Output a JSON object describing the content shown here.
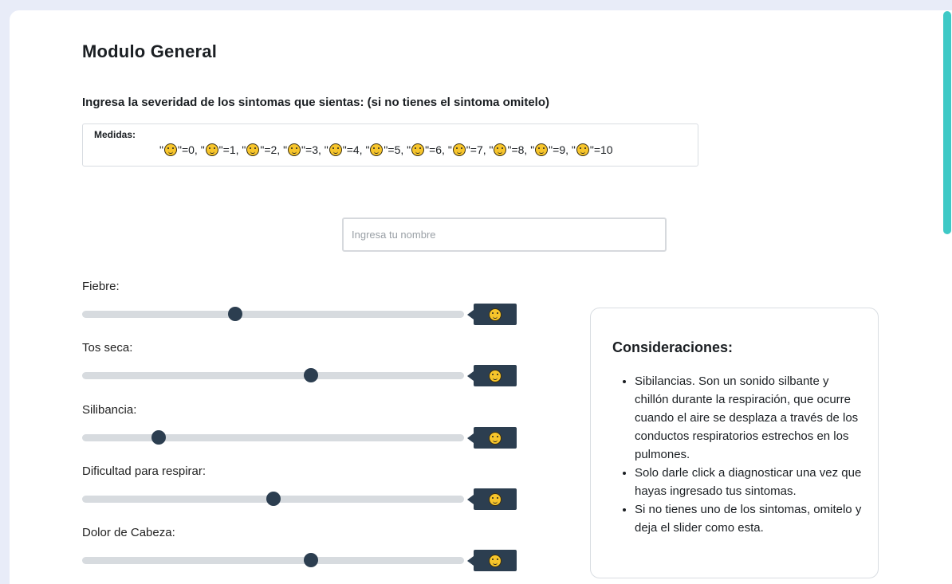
{
  "page": {
    "title": "Modulo General",
    "instructions": "Ingresa la severidad de los sintomas que sientas: (si no tienes el sintoma omitelo)"
  },
  "measures": {
    "label": "Medidas:",
    "scale": [
      {
        "text": "\"",
        "face": "slightly-smiling-face-icon",
        "value": "\"=0"
      },
      {
        "text": ", \"",
        "face": "confused-face-icon",
        "value": "\"=1"
      },
      {
        "text": ", \"",
        "face": "worried-face-icon",
        "value": "\"=2"
      },
      {
        "text": ", \"",
        "face": "persevering-face-icon",
        "value": "\"=3"
      },
      {
        "text": ", \"",
        "face": "tired-face-icon",
        "value": "\"=4"
      },
      {
        "text": ", \"",
        "face": "fearful-face-icon",
        "value": "\"=5"
      },
      {
        "text": ", \"",
        "face": "disappointed-face-icon",
        "value": "\"=6"
      },
      {
        "text": ", \"",
        "face": "crying-face-icon",
        "value": "\"=7"
      },
      {
        "text": ", \"",
        "face": "nauseated-face-icon",
        "value": "\"=8"
      },
      {
        "text": ", \"",
        "face": "sick-face-icon",
        "value": "\"=9"
      },
      {
        "text": ", \"",
        "face": "dizzy-face-icon",
        "value": "\"=10"
      }
    ]
  },
  "name_input": {
    "placeholder": "Ingresa tu nombre",
    "value": ""
  },
  "symptoms": [
    {
      "label": "Fiebre:",
      "level": 4,
      "max": 10,
      "face": "tired-face-icon"
    },
    {
      "label": "Tos seca:",
      "level": 6,
      "max": 10,
      "face": "disappointed-face-icon"
    },
    {
      "label": "Silibancia:",
      "level": 2,
      "max": 10,
      "face": "worried-face-icon"
    },
    {
      "label": "Dificultad para respirar:",
      "level": 5,
      "max": 10,
      "face": "fearful-face-icon"
    },
    {
      "label": "Dolor de Cabeza:",
      "level": 6,
      "max": 10,
      "face": "disappointed-face-icon"
    }
  ],
  "considerations": {
    "title": "Consideraciones:",
    "items": [
      "Sibilancias. Son un sonido silbante y chillón durante la respiración, que ocurre cuando el aire se desplaza a través de los conductos respiratorios estrechos en los pulmones.",
      "Solo darle click a diagnosticar una vez que hayas ingresado tus sintomas.",
      "Si no tienes uno de los sintomas, omitelo y deja el slider como esta."
    ]
  },
  "colors": {
    "background": "#e8ecf8",
    "slider_thumb": "#2c3e50",
    "slider_track": "#d7dbdf",
    "scrollbar": "#3ec9c6",
    "face_fill": "#f7c52b"
  }
}
